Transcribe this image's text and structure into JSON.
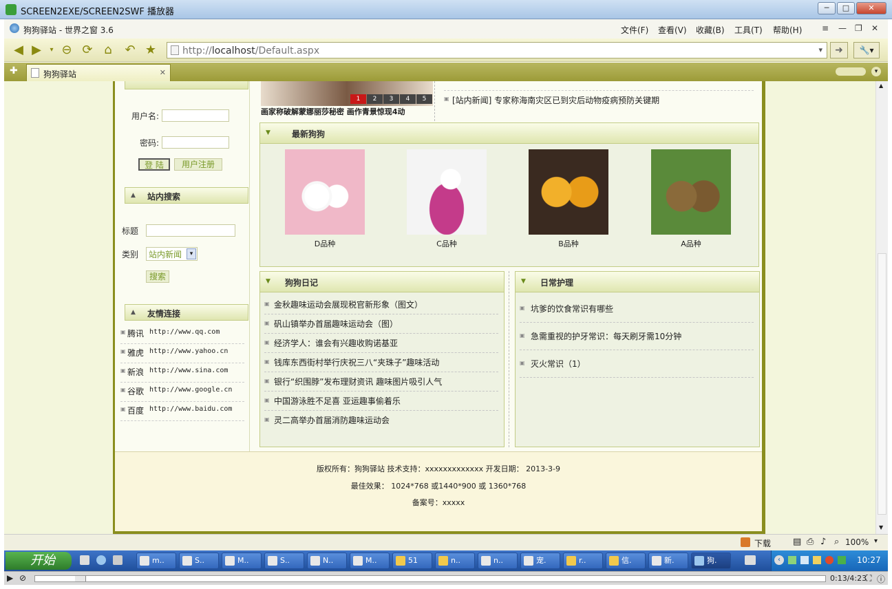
{
  "outer_window": {
    "title": "SCREEN2EXE/SCREEN2SWF 播放器",
    "min": "─",
    "max": "□",
    "close": "✕"
  },
  "browser": {
    "title": "狗狗驿站 - 世界之窗 3.6",
    "menu": [
      "文件(F)",
      "查看(V)",
      "收藏(B)",
      "工具(T)",
      "帮助(H)"
    ],
    "address": {
      "scheme": "http://",
      "host": "localhost",
      "path": "/Default.aspx"
    },
    "tab": {
      "label": "狗狗驿站",
      "close": "✕"
    },
    "add_tab": "✚"
  },
  "left": {
    "login": {
      "username_label": "用户名:",
      "password_label": "密码:",
      "login_button": "登 陆",
      "register_button": "用户注册"
    },
    "search": {
      "header": "站内搜索",
      "title_label": "标题",
      "category_label": "类别",
      "category_value": "站内新闻",
      "search_button": "搜索"
    },
    "links": {
      "header": "友情连接",
      "items": [
        {
          "name": "腾讯",
          "url": "http://www.qq.com"
        },
        {
          "name": "雅虎",
          "url": "http://www.yahoo.cn"
        },
        {
          "name": "新浪",
          "url": "http://www.sina.com"
        },
        {
          "name": "谷歌",
          "url": "http://www.google.cn"
        },
        {
          "name": "百度",
          "url": "http://www.baidu.com"
        }
      ]
    }
  },
  "slideshow": {
    "caption": "画家称破解蒙娜丽莎秘密 画作青景惊现4动",
    "pages": [
      "1",
      "2",
      "3",
      "4",
      "5"
    ]
  },
  "news": {
    "item": "[站内新闻] 专家称海南灾区已到灾后动物疫病预防关键期"
  },
  "latest_dogs": {
    "header": "最新狗狗",
    "items": [
      {
        "caption": "D品种",
        "color": "#f0b8c8"
      },
      {
        "caption": "C品种",
        "color": "#c43b8a"
      },
      {
        "caption": "B品种",
        "color": "#e0a020"
      },
      {
        "caption": "A品种",
        "color": "#8a6a3a"
      }
    ]
  },
  "diary": {
    "header": "狗狗日记",
    "items": [
      "金秋趣味运动会展现税官新形象（图文）",
      "矾山镇举办首届趣味运动会（图）",
      "经济学人：谁会有兴趣收购诺基亚",
      "钱库东西街村举行庆祝三八“夹珠子”趣味活动",
      "银行“织围脖”发布理财资讯 趣味图片吸引人气",
      "中国游泳胜不足喜 亚运趣事偷着乐",
      "灵二高举办首届消防趣味运动会"
    ]
  },
  "care": {
    "header": "日常护理",
    "items": [
      "坑爹的饮食常识有哪些",
      "急需重视的护牙常识：每天刷牙需10分钟",
      "灭火常识（1）"
    ]
  },
  "footer": {
    "line1": "版权所有：狗狗驿站 技术支持：xxxxxxxxxxxxx 开发日期： 2013-3-9",
    "line2": "最佳效果： 1024*768 或1440*900 或 1360*768",
    "line3": "备案号：xxxxx"
  },
  "statusbar": {
    "download": "下载",
    "zoom": "100%"
  },
  "taskbar": {
    "start": "开始",
    "buttons": [
      "m..",
      "S..",
      "M..",
      "S..",
      "N..",
      "M..",
      "51",
      "n..",
      "n..",
      "宠.",
      "r..",
      "信.",
      "新.",
      "狗."
    ],
    "clock": "10:27"
  },
  "player": {
    "time": "0:13/4:23"
  },
  "colors": {
    "accent_olive": "#8a8e1e",
    "header_green": "#dfe6b0",
    "taskbar_blue": "#2d5fb0"
  }
}
